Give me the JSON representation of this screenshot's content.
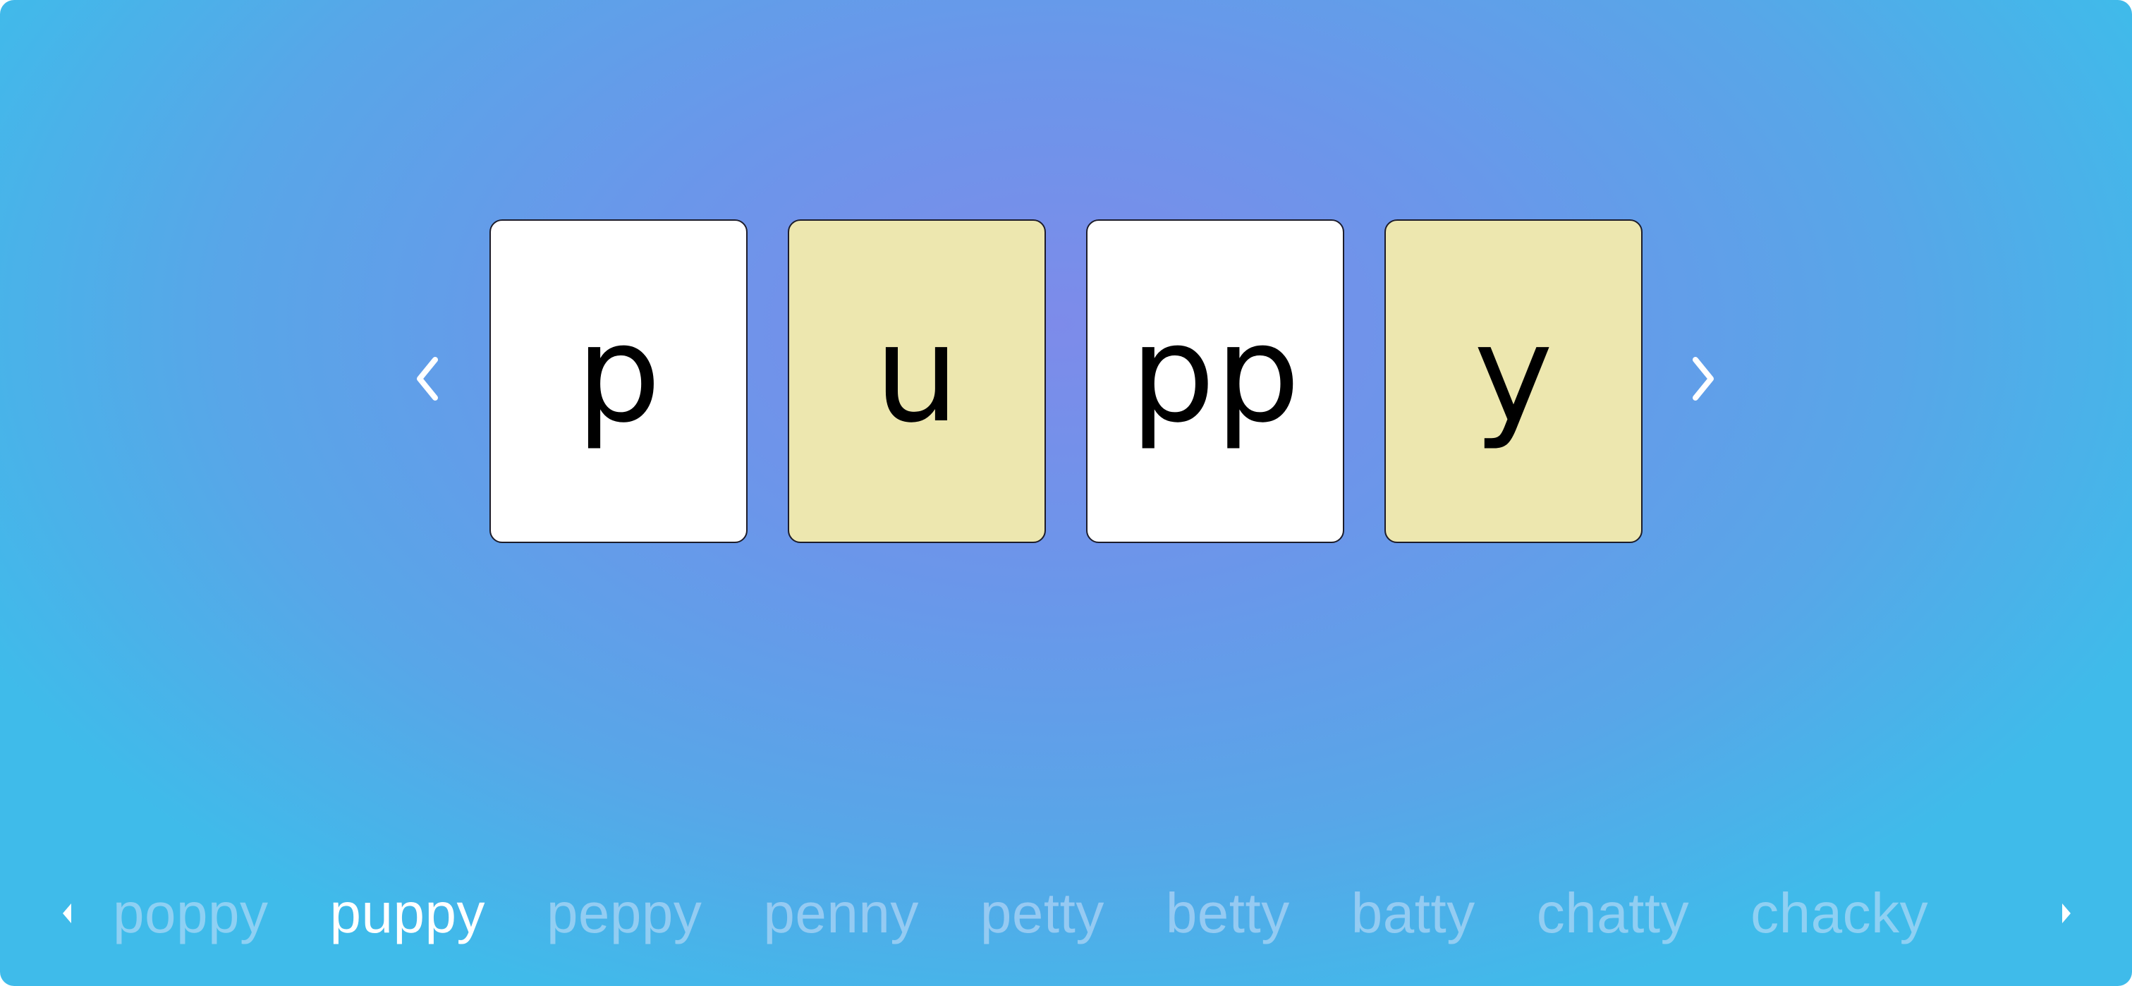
{
  "word_builder": {
    "prev_icon": "chevron-left-icon",
    "next_icon": "chevron-right-icon",
    "tiles": [
      {
        "text": "p",
        "color": "#ffffff"
      },
      {
        "text": "u",
        "color": "#ede7af"
      },
      {
        "text": "pp",
        "color": "#ffffff"
      },
      {
        "text": "y",
        "color": "#ede7af"
      }
    ]
  },
  "word_list": {
    "prev_icon": "caret-left-icon",
    "next_icon": "caret-right-icon",
    "selected": "puppy",
    "words": [
      "poppy",
      "puppy",
      "peppy",
      "penny",
      "petty",
      "betty",
      "batty",
      "chatty",
      "chacky"
    ]
  },
  "colors": {
    "tile_light": "#ffffff",
    "tile_tan": "#ede7af",
    "background_center": "#7d8bea",
    "background_edge": "#3fbbea"
  }
}
